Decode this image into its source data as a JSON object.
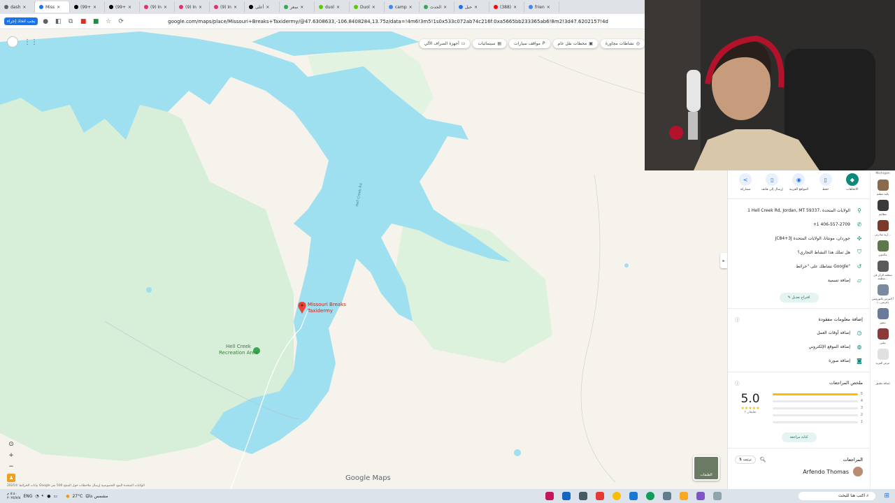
{
  "browser": {
    "tabs": [
      {
        "label": "dash"
      },
      {
        "label": "Miss",
        "active": true
      },
      {
        "label": "(99+"
      },
      {
        "label": "(99+"
      },
      {
        "label": "(9) In"
      },
      {
        "label": "(9) In"
      },
      {
        "label": "(9) In"
      },
      {
        "label": "أعلى"
      },
      {
        "label": "سعر"
      },
      {
        "label": "duol"
      },
      {
        "label": "Duol"
      },
      {
        "label": "camp"
      },
      {
        "label": "الحدث"
      },
      {
        "label": "حبل"
      },
      {
        "label": "(388)"
      },
      {
        "label": "frien"
      }
    ],
    "url": "google.com/maps/place/Missouri+Breaks+Taxidermy/@47.6308633,-106.8408284,13.75z/data=!4m6!3m5!1s0x533c072ab74c216f:0xa5665bb233365ab6!8m2!3d47.6202157!4d-106.8834252!16s%2Fg%2F1",
    "ext_button": "يجب اتخاذ إجراء"
  },
  "map": {
    "chips": [
      {
        "label": "نشاطات مجاورة",
        "icon": "camera-icon"
      },
      {
        "label": "محطات نقل عام",
        "icon": "bus-icon"
      },
      {
        "label": "مواقف سيارات",
        "icon": "parking-icon"
      },
      {
        "label": "سينمائيات",
        "icon": "film-icon"
      },
      {
        "label": "أجهزة الصراف الآلي",
        "icon": "atm-icon"
      }
    ],
    "pin_label": "Missouri Breaks Taxidermy",
    "rec_area_label": "Hell Creek Recreation Area",
    "road_label": "Hell Creek Rd",
    "logo": "Google Maps",
    "layers_label": "الطبقات",
    "attribution": "بيانات الخرائط ©2025 Google الولايات المتحدة  البنود  الخصوصية  إرسال ملاحظات حول المنتج  500 متر"
  },
  "panel": {
    "actions": [
      {
        "label": "الاتجاهات",
        "icon": "directions-icon",
        "primary": true
      },
      {
        "label": "حفظ",
        "icon": "bookmark-icon"
      },
      {
        "label": "المواقع القريبة",
        "icon": "nearby-icon"
      },
      {
        "label": "إرسال إلى هاتف",
        "icon": "phone-send-icon"
      },
      {
        "label": "مشاركة",
        "icon": "share-icon"
      }
    ],
    "info": [
      {
        "text": "1 Hell Creek Rd, Jordan, MT 59337، الولايات المتحدة",
        "icon": "location-icon"
      },
      {
        "text": "+1 406-557-2709",
        "icon": "phone-icon"
      },
      {
        "text": "JC84+3J جوردان، مونتانا، الولايات المتحدة",
        "icon": "plus-code-icon"
      },
      {
        "text": "هل تملك هذا النشاط التجاري؟",
        "icon": "verified-icon"
      },
      {
        "text": "نشاطك على \"خرائط Google\"",
        "icon": "history-icon"
      },
      {
        "text": "إضافة تسمية",
        "icon": "label-icon"
      }
    ],
    "suggest_edit": "اقتراح تعديل",
    "missing_info": {
      "title": "إضافة معلومات مفقودة",
      "items": [
        {
          "text": "إضافة أوقات العمل",
          "icon": "clock-icon"
        },
        {
          "text": "إضافة الموقع الإلكتروني",
          "icon": "globe-icon"
        },
        {
          "text": "إضافة صورة",
          "icon": "camera-icon"
        }
      ]
    },
    "reviews_summary": {
      "title": "ملخص المراجعات",
      "score": "5.0",
      "stars": "★★★★★",
      "count_text": "تعليقان ٣",
      "bars": [
        {
          "label": "5",
          "fraction": 1.0
        },
        {
          "label": "4",
          "fraction": 0.0
        },
        {
          "label": "3",
          "fraction": 0.0
        },
        {
          "label": "2",
          "fraction": 0.0
        },
        {
          "label": "1",
          "fraction": 0.0
        }
      ],
      "write_review": "كتابة مراجعة"
    },
    "reviews": {
      "title": "المراجعات",
      "sort_label": "ترتيب",
      "first_reviewer": "Arfendo Thomas"
    }
  },
  "side_strip": {
    "title": "Michigan",
    "items": [
      {
        "label": "بالبة مطعم",
        "color": "#8a6a4a"
      },
      {
        "label": "مطاعم",
        "color": "#3a3a3a"
      },
      {
        "label": "ارية مبادرتي...",
        "color": "#7a3b2b"
      },
      {
        "label": "ماكدونز",
        "color": "#5a7a4a"
      },
      {
        "label": "منظمة الرأي في منظمة...",
        "color": "#5a5a5a"
      },
      {
        "label": "أ المزمن بالتورونس (فرنس...)",
        "color": "#7a8aa0"
      },
      {
        "label": "تيمور",
        "color": "#6a7a9a"
      },
      {
        "label": "مكين",
        "color": "#8a3a3a"
      },
      {
        "label": "عرض المزيد",
        "color": "#e0e0e0"
      },
      {
        "label": "إضافة تطبيق",
        "color": "#ffffff"
      }
    ]
  },
  "taskbar": {
    "time": "٥:٤٠ م",
    "date": "٢٠٢٥/٧/٨",
    "lang": "ENG",
    "weather_temp": "27°C",
    "weather_text": "مشمس غالبًا",
    "search_placeholder": "اكتب هنا للبحث"
  }
}
